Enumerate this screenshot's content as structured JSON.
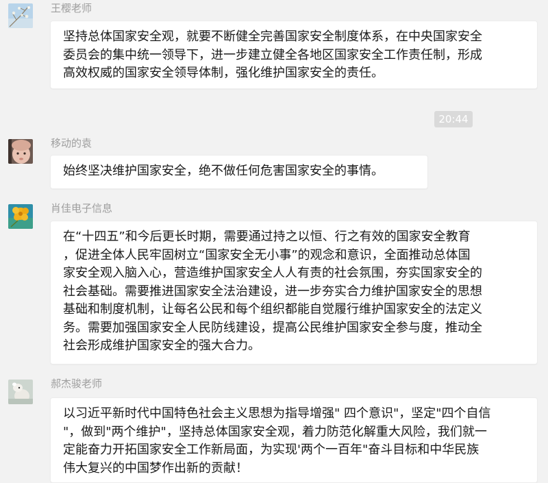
{
  "messages": [
    {
      "sender": "王樱老师",
      "text": "坚持总体国家安全观，就要不断健全完善国家安全制度体系，在中央国家安全\n委员会的集中统一领导下，进一步建立健全各地区国家安全工作责任制，形成\n高效权威的国家安全领导体制，强化维护国家安全的责任。"
    },
    {
      "sender": "移动的袁",
      "text": "始终坚决维护国家安全，绝不做任何危害国家安全的事情。"
    },
    {
      "sender": "肖佳电子信息",
      "text": "在“十四五”和今后更长时期，需要通过持之以恒、行之有效的国家安全教育\n，促进全体人民牢固树立“国家安全无小事”的观念和意识，全面推动总体国\n家安全观入脑入心，营造维护国家安全人人有责的社会氛围，夯实国家安全的\n社会基础。需要推进国家安全法治建设，进一步夯实合力维护国家安全的思想\n基础和制度机制，让每名公民和每个组织都能自觉履行维护国家安全的法定义\n务。需要加强国家安全人民防线建设，提高公民维护国家安全参与度，推动全\n社会形成维护国家安全的强大合力。"
    },
    {
      "sender": "郝杰骏老师",
      "text": "以习近平新时代中国特色社会主义思想为指导增强\" 四个意识\"，坚定\"四个自信\n\"，做到\"两个维护\"，坚持总体国家安全观，着力防范化解重大风险，我们就一\n定能奋力开拓国家安全工作新局面，为实现'两个一百年\"奋斗目标和中华民族\n伟大复兴的中国梦作出新的贡献！"
    }
  ],
  "timestamp": "20:44",
  "avatars": [
    "tree-branch-avatar",
    "baby-photo-avatar",
    "yellow-flower-avatar",
    "plush-toy-avatar"
  ]
}
